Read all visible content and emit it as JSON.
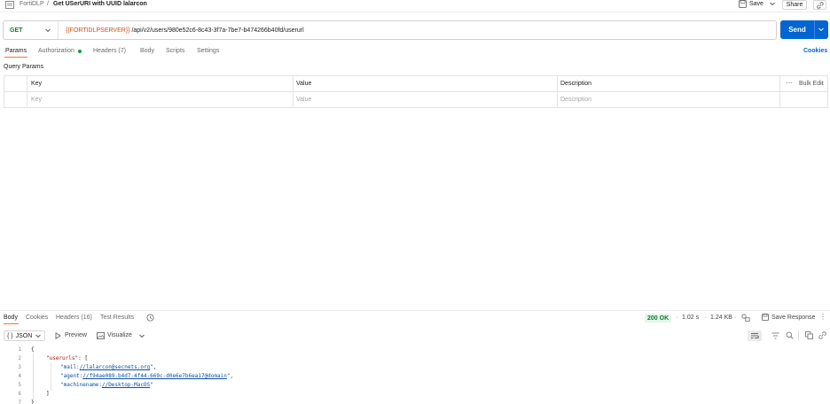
{
  "header": {
    "workspace": "FortiDLP",
    "separator": "/",
    "request_name": "Get USerURI with UUID lalarcon",
    "save_label": "Save",
    "share_label": "Share"
  },
  "request": {
    "method": "GET",
    "url_variable": "{{FORTIDLPSERVER}}",
    "url_path": " /api/v2/users/980e52c6-8c43-3f7a-7be7-b474266b40fd/userurl",
    "send_label": "Send"
  },
  "request_tabs": {
    "params": "Params",
    "authorization": "Authorization",
    "headers": "Headers (7)",
    "body": "Body",
    "scripts": "Scripts",
    "settings": "Settings",
    "cookies": "Cookies"
  },
  "query_params": {
    "title": "Query Params",
    "col_key": "Key",
    "col_value": "Value",
    "col_description": "Description",
    "bulk_edit": "Bulk Edit",
    "row_placeholders": {
      "key": "Key",
      "value": "Value",
      "description": "Description"
    }
  },
  "response_tabs": {
    "body": "Body",
    "cookies": "Cookies",
    "headers": "Headers (16)",
    "test_results": "Test Results"
  },
  "response_meta": {
    "status": "200 OK",
    "time": "1.02 s",
    "size": "1.24 KB",
    "save_response": "Save Response"
  },
  "response_toolbar": {
    "format": "JSON",
    "preview": "Preview",
    "visualize": "Visualize"
  },
  "response_body": {
    "line_numbers": [
      "1",
      "2",
      "3",
      "4",
      "5",
      "6",
      "7"
    ],
    "l1": "{",
    "l2_key": "\"userurls\"",
    "l2_rest": ": [",
    "l3_pre": "\"mail:",
    "l3_link": "//lalarcon@secnets.org",
    "l3_post": "\",",
    "l4_pre": "\"agent:",
    "l4_link": "//f94ae089-b4d7-4f44-669c-d0e6e7b6ea17@domain",
    "l4_post": "\",",
    "l5_pre": "\"machinename:",
    "l5_link": "//Desktop-MacOS",
    "l5_post": "\"",
    "l6": "]",
    "l7": "}"
  },
  "colors": {
    "accent": "#ff6c37",
    "send": "#0265d2",
    "get_method": "#0a7d30",
    "variable": "#d9480f",
    "status_ok": "#0a7d30"
  }
}
